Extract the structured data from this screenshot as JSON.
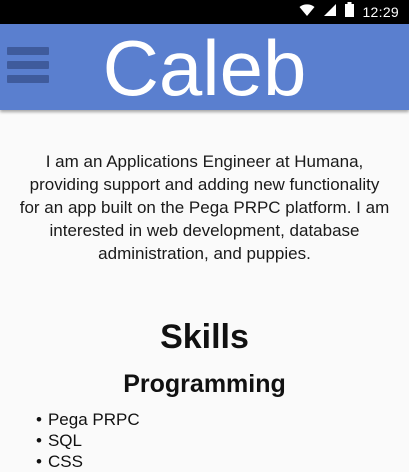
{
  "status_bar": {
    "time": "12:29",
    "icons": [
      "wifi-icon",
      "signal-icon",
      "battery-icon"
    ]
  },
  "header": {
    "title": "Caleb",
    "menu_icon": "hamburger-menu-icon",
    "background_color": "#5a7fcf"
  },
  "main": {
    "bio": "I am an Applications Engineer at Humana, providing support and adding new functionality for an app built on the Pega PRPC platform. I am interested in web development, database administration, and puppies.",
    "skills_heading": "Skills",
    "sections": [
      {
        "heading": "Programming",
        "items": [
          "Pega PRPC",
          "SQL",
          "CSS"
        ]
      }
    ]
  }
}
